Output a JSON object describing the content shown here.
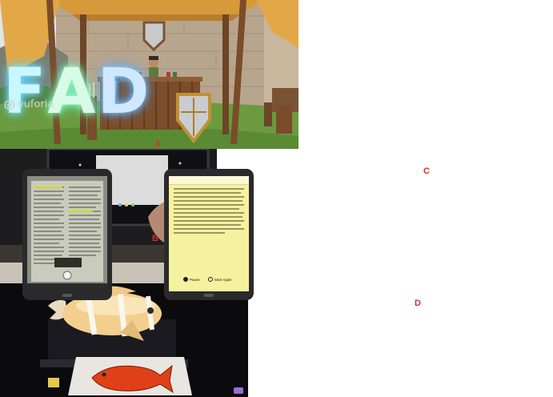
{
  "panels": {
    "a": {
      "label": "A"
    },
    "b": {
      "label": "B",
      "buttons": {
        "pause": "Pause",
        "start_again": "Start Again"
      }
    },
    "c": {
      "label": "C",
      "letters": [
        "F",
        "A",
        "D"
      ]
    },
    "d": {
      "label": "D",
      "brand": "vuforia"
    }
  },
  "colors": {
    "label_red": "#d3302f",
    "glow": "#8ef0ff",
    "paper_yellow": "#f6f19e"
  }
}
